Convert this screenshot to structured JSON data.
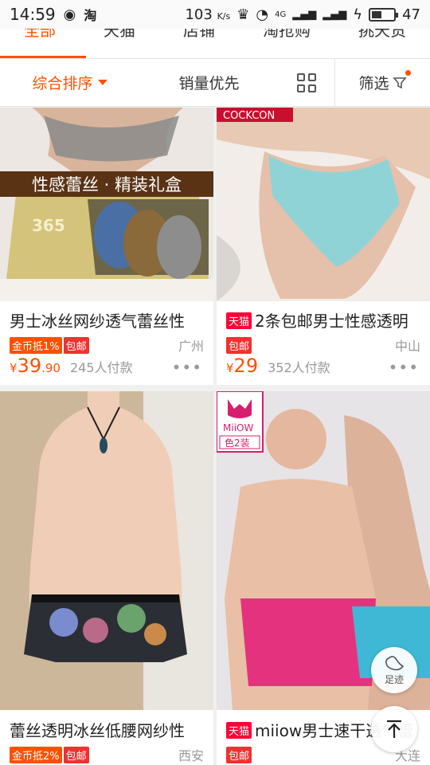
{
  "status_bar": {
    "time": "14:59",
    "speed": "103",
    "speed_unit": "K/s",
    "network": "4G",
    "battery_level": "47",
    "battery_fraction": 0.47
  },
  "category_tabs": [
    {
      "label": "全部",
      "active": true
    },
    {
      "label": "天猫"
    },
    {
      "label": "店铺"
    },
    {
      "label": "淘抢购"
    },
    {
      "label": "挑天货"
    }
  ],
  "sort_bar": {
    "comprehensive": "综合排序",
    "sales_first": "销量优先",
    "filter": "筛选"
  },
  "products": [
    {
      "banner": "性感蕾丝 · 精装礼盒",
      "title": "男士冰丝网纱透气蕾丝性",
      "tags": [
        "金币抵1%",
        "包邮"
      ],
      "location": "广州",
      "currency": "¥",
      "price_int": "39",
      "price_dec": ".90",
      "sales": "245人付款",
      "tmall": false
    },
    {
      "brand_label": "COCKCON",
      "title": "2条包邮男士性感透明",
      "tags": [
        "包邮"
      ],
      "location": "中山",
      "currency": "¥",
      "price_int": "29",
      "price_dec": "",
      "sales": "352人付款",
      "tmall": true,
      "tmall_label": "天猫"
    },
    {
      "title": "蕾丝透明冰丝低腰网纱性",
      "tags": [
        "金币抵2%",
        "包邮"
      ],
      "location": "西安",
      "tmall": false
    },
    {
      "brand_logo_text": "MiiOW",
      "brand_sub": "色2装",
      "title": "miiow男士速干透气蕾",
      "tags": [
        "包邮"
      ],
      "location": "大连",
      "tmall": true,
      "tmall_label": "天猫"
    }
  ],
  "floating": {
    "footprint_label": "足迹"
  },
  "colors": {
    "accent": "#ff5000",
    "tmall": "#ff0036"
  }
}
